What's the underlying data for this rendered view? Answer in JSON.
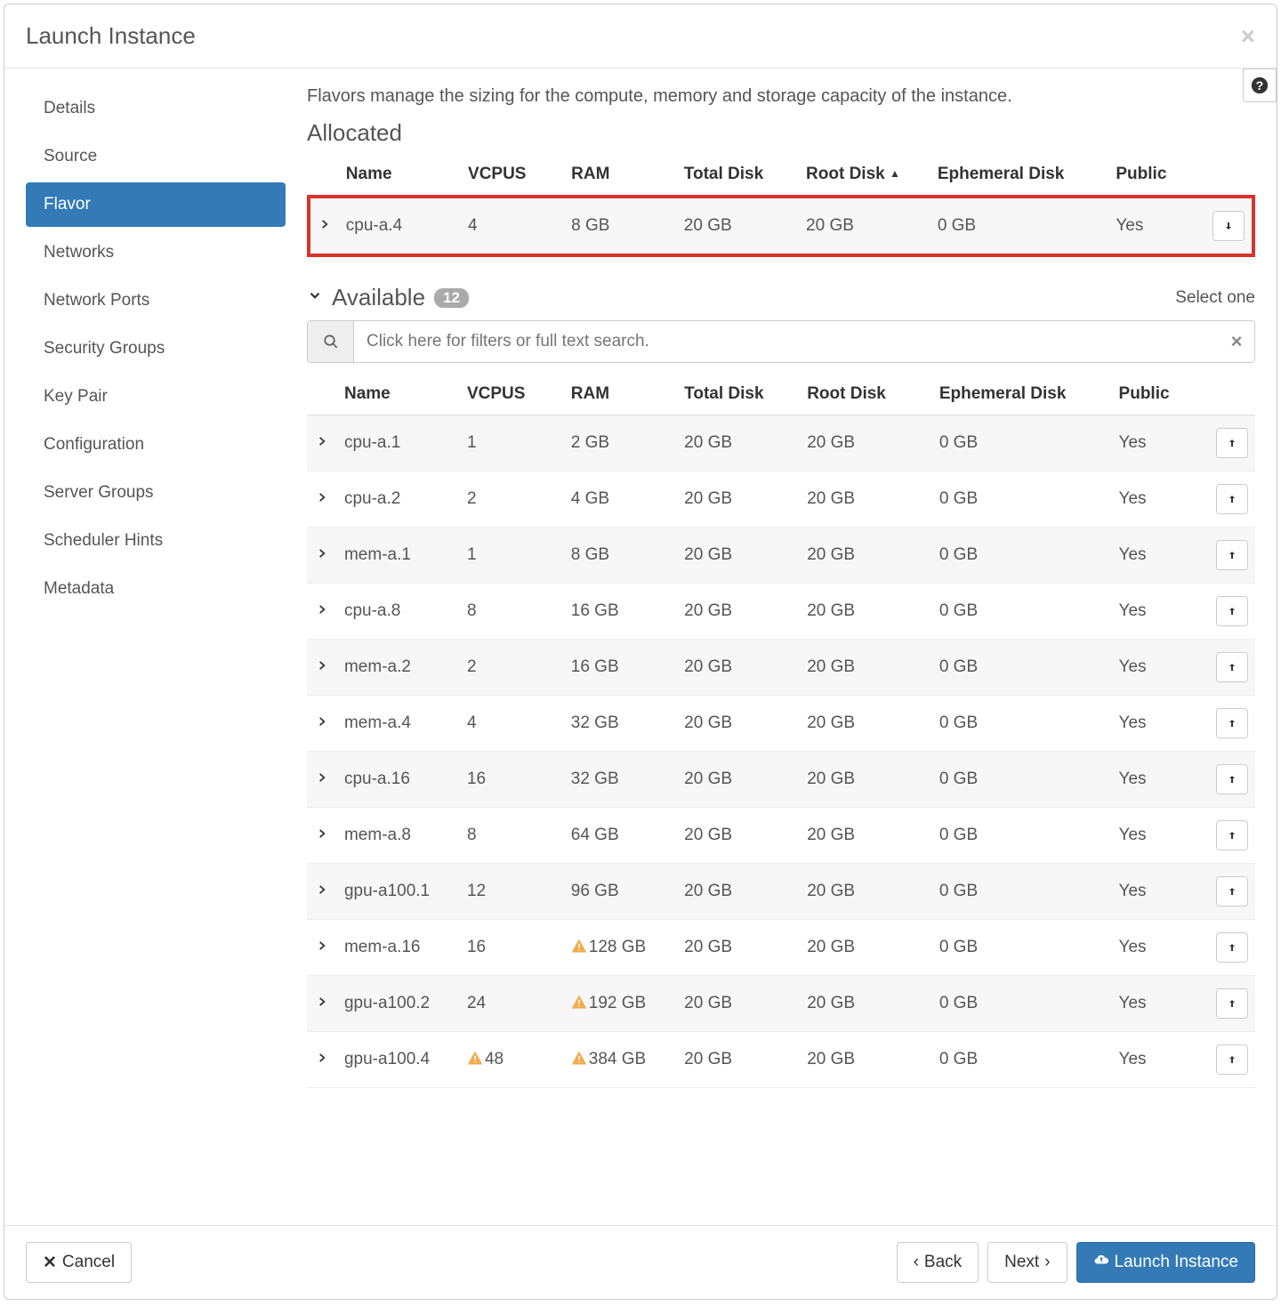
{
  "modal": {
    "title": "Launch Instance"
  },
  "sidebar": {
    "items": [
      {
        "label": "Details"
      },
      {
        "label": "Source"
      },
      {
        "label": "Flavor"
      },
      {
        "label": "Networks"
      },
      {
        "label": "Network Ports"
      },
      {
        "label": "Security Groups"
      },
      {
        "label": "Key Pair"
      },
      {
        "label": "Configuration"
      },
      {
        "label": "Server Groups"
      },
      {
        "label": "Scheduler Hints"
      },
      {
        "label": "Metadata"
      }
    ],
    "active_index": 2
  },
  "content": {
    "description": "Flavors manage the sizing for the compute, memory and storage capacity of the instance.",
    "allocated_title": "Allocated",
    "available_title": "Available",
    "available_count": "12",
    "select_one": "Select one",
    "search_placeholder": "Click here for filters or full text search."
  },
  "columns": {
    "name": "Name",
    "vcpus": "VCPUS",
    "ram": "RAM",
    "total": "Total Disk",
    "root": "Root Disk",
    "eph": "Ephemeral Disk",
    "public": "Public",
    "root_sorted": "Root Disk "
  },
  "allocated": [
    {
      "name": "cpu-a.4",
      "vcpus": "4",
      "ram": "8 GB",
      "total": "20 GB",
      "root": "20 GB",
      "eph": "0 GB",
      "public": "Yes"
    }
  ],
  "available": [
    {
      "name": "cpu-a.1",
      "vcpus": "1",
      "ram": "2 GB",
      "total": "20 GB",
      "root": "20 GB",
      "eph": "0 GB",
      "public": "Yes",
      "warn_vcpus": false,
      "warn_ram": false
    },
    {
      "name": "cpu-a.2",
      "vcpus": "2",
      "ram": "4 GB",
      "total": "20 GB",
      "root": "20 GB",
      "eph": "0 GB",
      "public": "Yes",
      "warn_vcpus": false,
      "warn_ram": false
    },
    {
      "name": "mem-a.1",
      "vcpus": "1",
      "ram": "8 GB",
      "total": "20 GB",
      "root": "20 GB",
      "eph": "0 GB",
      "public": "Yes",
      "warn_vcpus": false,
      "warn_ram": false
    },
    {
      "name": "cpu-a.8",
      "vcpus": "8",
      "ram": "16 GB",
      "total": "20 GB",
      "root": "20 GB",
      "eph": "0 GB",
      "public": "Yes",
      "warn_vcpus": false,
      "warn_ram": false
    },
    {
      "name": "mem-a.2",
      "vcpus": "2",
      "ram": "16 GB",
      "total": "20 GB",
      "root": "20 GB",
      "eph": "0 GB",
      "public": "Yes",
      "warn_vcpus": false,
      "warn_ram": false
    },
    {
      "name": "mem-a.4",
      "vcpus": "4",
      "ram": "32 GB",
      "total": "20 GB",
      "root": "20 GB",
      "eph": "0 GB",
      "public": "Yes",
      "warn_vcpus": false,
      "warn_ram": false
    },
    {
      "name": "cpu-a.16",
      "vcpus": "16",
      "ram": "32 GB",
      "total": "20 GB",
      "root": "20 GB",
      "eph": "0 GB",
      "public": "Yes",
      "warn_vcpus": false,
      "warn_ram": false
    },
    {
      "name": "mem-a.8",
      "vcpus": "8",
      "ram": "64 GB",
      "total": "20 GB",
      "root": "20 GB",
      "eph": "0 GB",
      "public": "Yes",
      "warn_vcpus": false,
      "warn_ram": false
    },
    {
      "name": "gpu-a100.1",
      "vcpus": "12",
      "ram": "96 GB",
      "total": "20 GB",
      "root": "20 GB",
      "eph": "0 GB",
      "public": "Yes",
      "warn_vcpus": false,
      "warn_ram": false
    },
    {
      "name": "mem-a.16",
      "vcpus": "16",
      "ram": "128 GB",
      "total": "20 GB",
      "root": "20 GB",
      "eph": "0 GB",
      "public": "Yes",
      "warn_vcpus": false,
      "warn_ram": true
    },
    {
      "name": "gpu-a100.2",
      "vcpus": "24",
      "ram": "192 GB",
      "total": "20 GB",
      "root": "20 GB",
      "eph": "0 GB",
      "public": "Yes",
      "warn_vcpus": false,
      "warn_ram": true
    },
    {
      "name": "gpu-a100.4",
      "vcpus": "48",
      "ram": "384 GB",
      "total": "20 GB",
      "root": "20 GB",
      "eph": "0 GB",
      "public": "Yes",
      "warn_vcpus": true,
      "warn_ram": true
    }
  ],
  "footer": {
    "cancel": "Cancel",
    "back": "Back",
    "next": "Next",
    "launch": "Launch Instance"
  }
}
